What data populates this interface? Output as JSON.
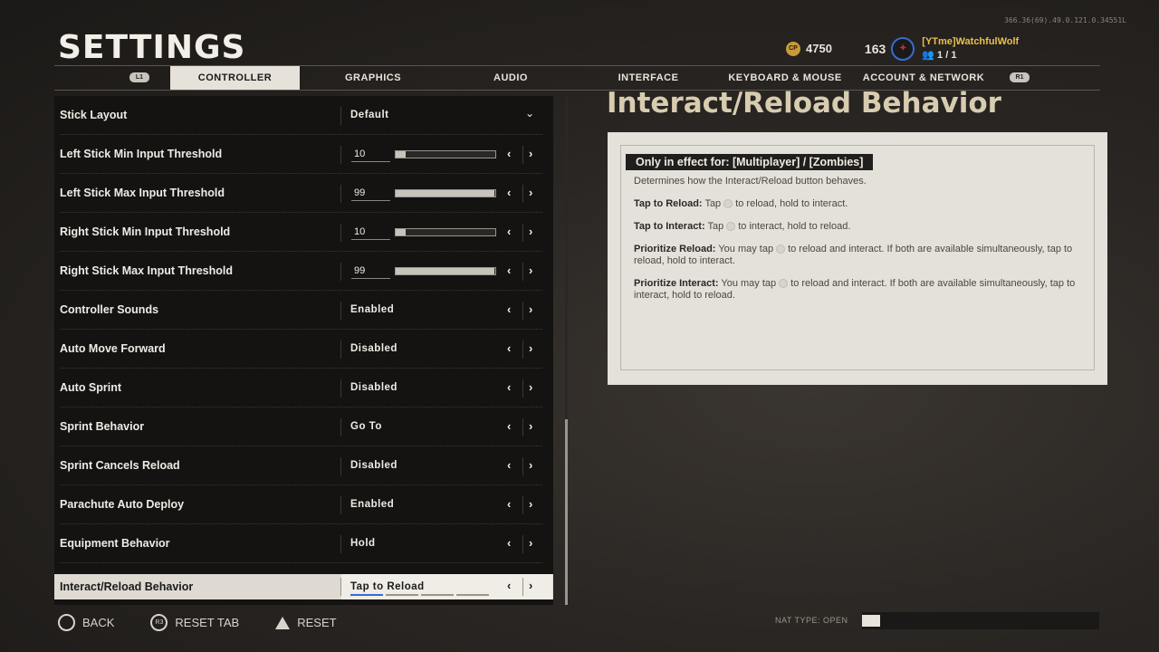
{
  "build_info": "366.36(69).49.0.121.0.34551L",
  "page_title": "SETTINGS",
  "header": {
    "cp_icon": "CP",
    "cp_amount": "4750",
    "level": "163",
    "player_name": "[YTme]WatchfulWolf",
    "party_count": "1 / 1"
  },
  "tabs": {
    "left_bumper": "L1",
    "right_bumper": "R1",
    "items": [
      "CONTROLLER",
      "GRAPHICS",
      "AUDIO",
      "INTERFACE",
      "KEYBOARD & MOUSE",
      "ACCOUNT & NETWORK"
    ]
  },
  "settings": {
    "rows": [
      {
        "label": "Stick Layout",
        "value": "Default"
      },
      {
        "label": "Left Stick Min Input Threshold",
        "value": "10",
        "level": 0.1
      },
      {
        "label": "Left Stick Max Input Threshold",
        "value": "99",
        "level": 0.99
      },
      {
        "label": "Right Stick Min Input Threshold",
        "value": "10",
        "level": 0.1
      },
      {
        "label": "Right Stick Max Input Threshold",
        "value": "99",
        "level": 0.99
      },
      {
        "label": "Controller Sounds",
        "value": "Enabled"
      },
      {
        "label": "Auto Move Forward",
        "value": "Disabled"
      },
      {
        "label": "Auto Sprint",
        "value": "Disabled"
      },
      {
        "label": "Sprint Behavior",
        "value": "Go To"
      },
      {
        "label": "Sprint Cancels Reload",
        "value": "Disabled"
      },
      {
        "label": "Parachute Auto Deploy",
        "value": "Enabled"
      },
      {
        "label": "Equipment Behavior",
        "value": "Hold"
      },
      {
        "label": "Interact/Reload Behavior",
        "value": "Tap to Reload"
      }
    ]
  },
  "detail": {
    "title": "Interact/Reload Behavior",
    "badge": "Only in effect for: [Multiplayer] / [Zombies]",
    "intro": "Determines how the Interact/Reload button behaves.",
    "tap_reload_label": "Tap to Reload:",
    "tap_reload_a": "Tap",
    "tap_reload_b": "to reload, hold to interact.",
    "tap_interact_label": "Tap to Interact:",
    "tap_interact_a": "Tap",
    "tap_interact_b": "to interact, hold to reload.",
    "prio_reload_label": "Prioritize Reload:",
    "prio_reload_a": "You may tap",
    "prio_reload_b": "to reload and interact. If both are available simultaneously, tap to reload, hold to interact.",
    "prio_interact_label": "Prioritize Interact:",
    "prio_interact_a": "You may tap",
    "prio_interact_b": "to reload and interact. If both are available simultaneously, tap to interact, hold to reload."
  },
  "footer": {
    "back_icon": "circle-button",
    "back": "BACK",
    "reset_tab_icon": "R3",
    "reset_tab": "RESET TAB",
    "reset_icon": "triangle-button",
    "reset": "RESET",
    "nat_type": "NAT TYPE: OPEN"
  }
}
